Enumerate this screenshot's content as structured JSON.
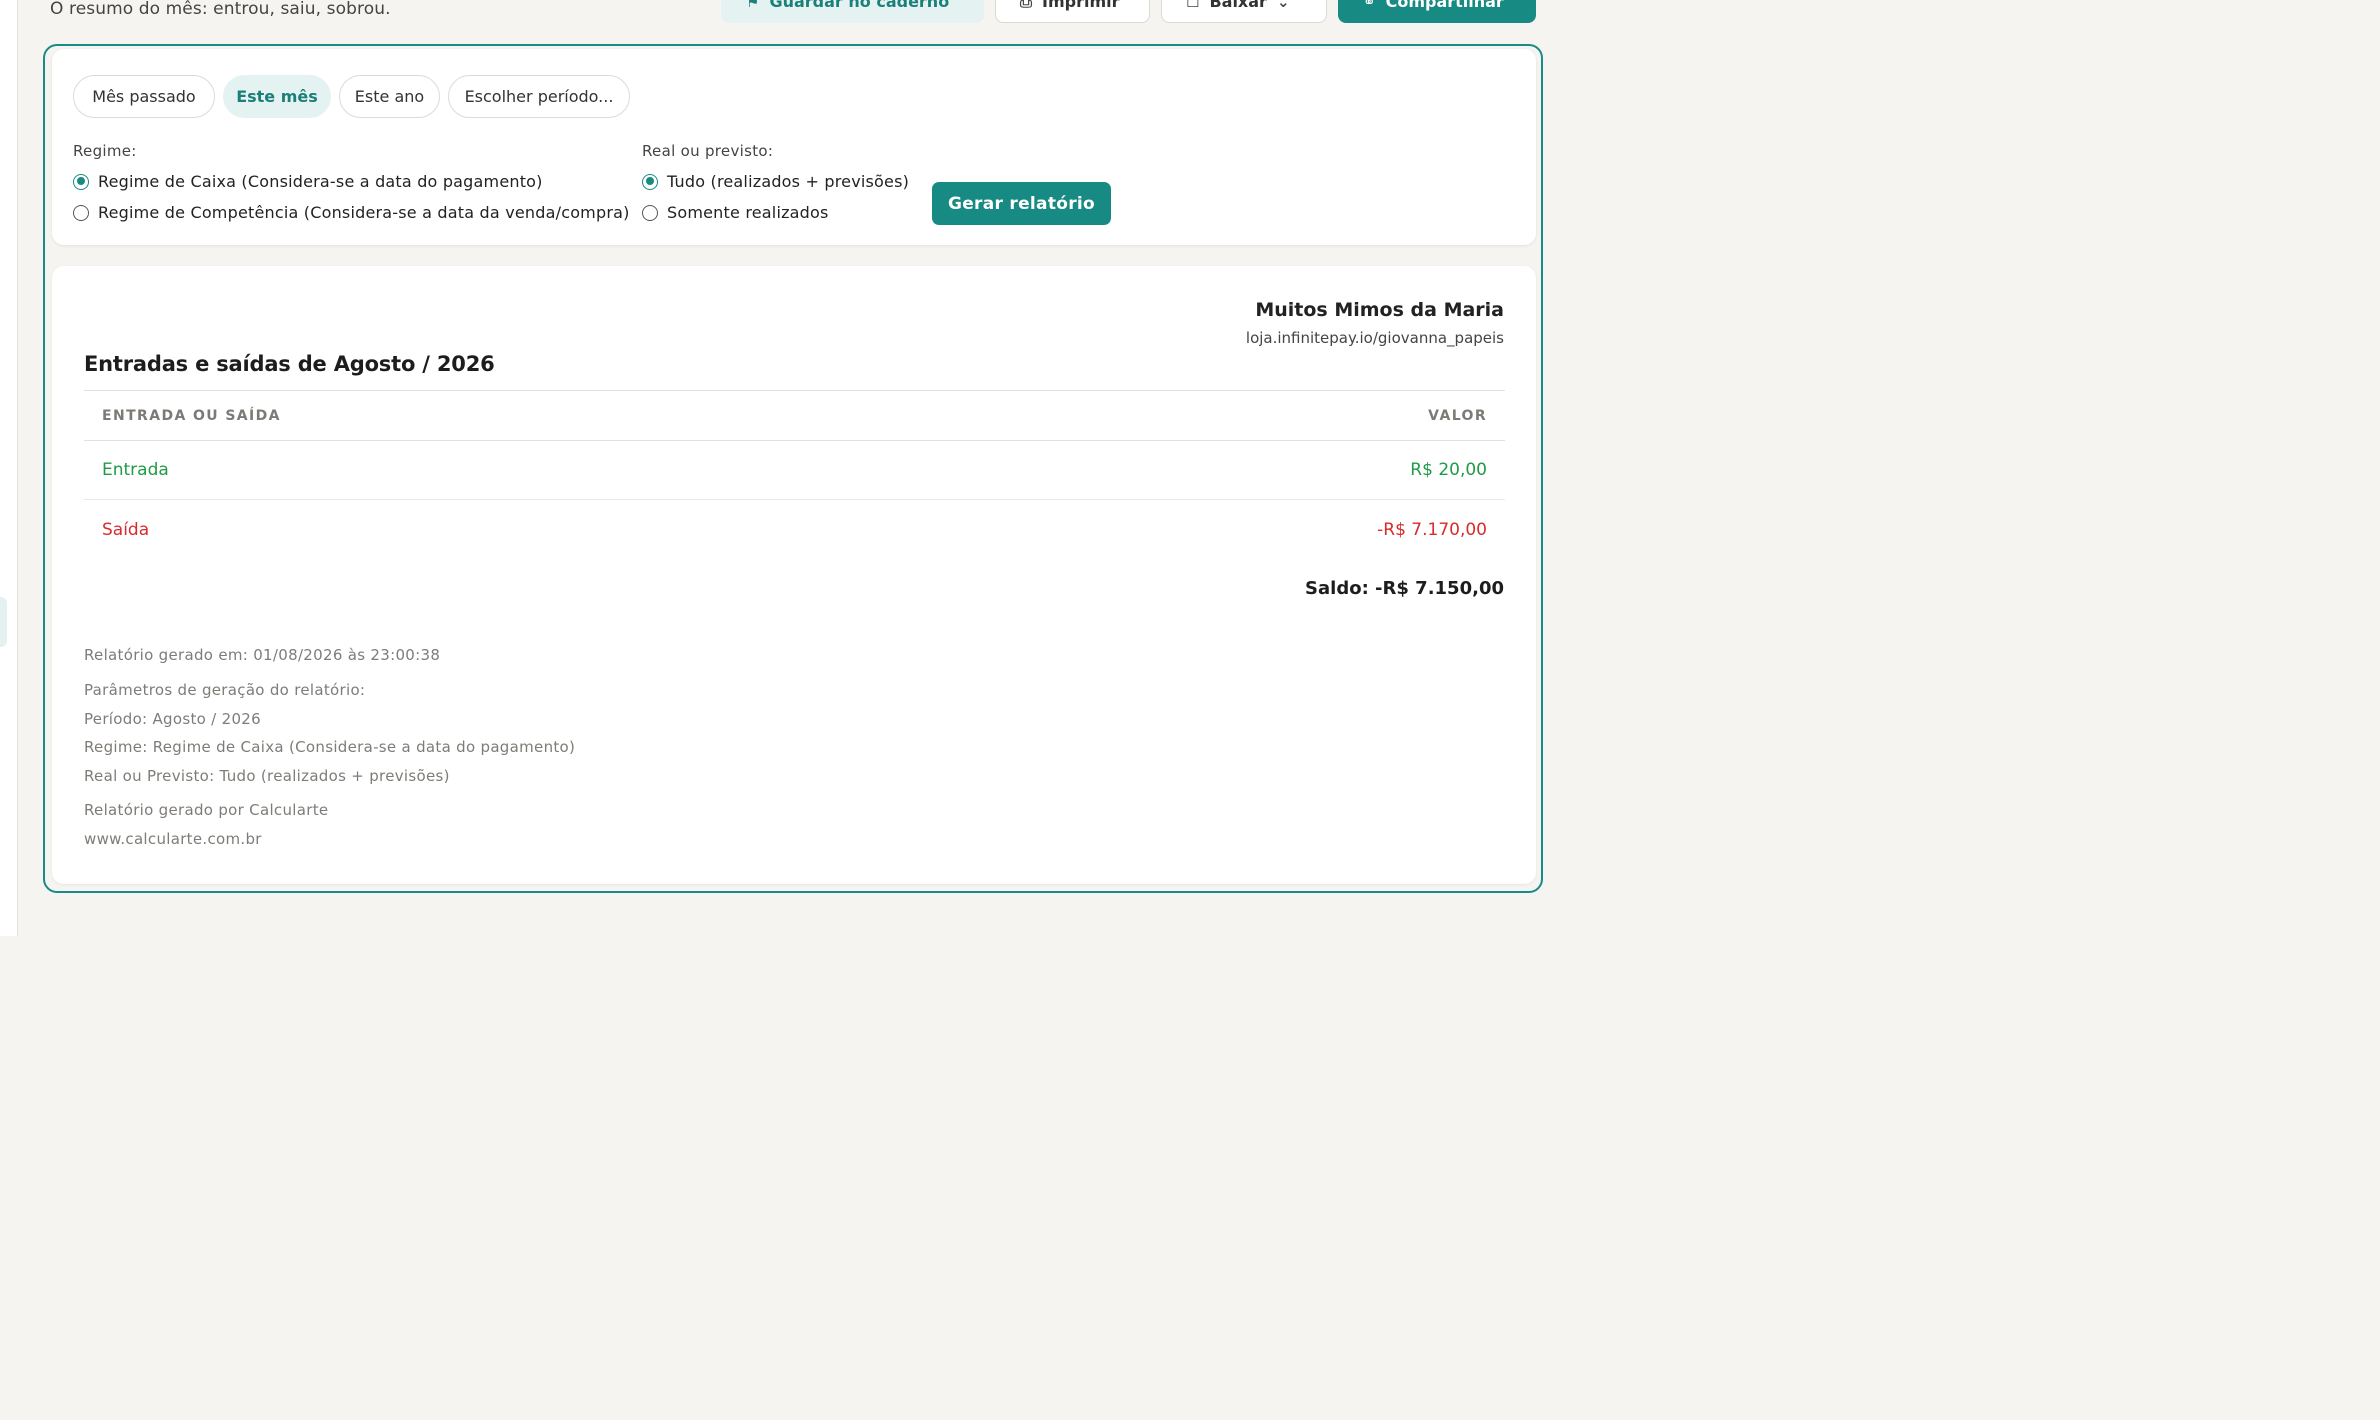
{
  "header": {
    "subtitle": "O resumo do mês: entrou, saiu, sobrou.",
    "buttons": {
      "save": "Guardar no caderno",
      "print": "Imprimir",
      "download": "Baixar",
      "share": "Compartilhar"
    }
  },
  "filters": {
    "periods": [
      "Mês passado",
      "Este mês",
      "Este ano",
      "Escolher período..."
    ],
    "active_period": "Este mês",
    "regime": {
      "label": "Regime:",
      "options": [
        "Regime de Caixa (Considera-se a data do pagamento)",
        "Regime de Competência (Considera-se a data da venda/compra)"
      ],
      "selected": "Regime de Caixa (Considera-se a data do pagamento)"
    },
    "real_previsto": {
      "label": "Real ou previsto:",
      "options": [
        "Tudo (realizados + previsões)",
        "Somente realizados"
      ],
      "selected": "Tudo (realizados + previsões)"
    },
    "generate_label": "Gerar relatório"
  },
  "report": {
    "company": "Muitos Mimos da Maria",
    "company_url": "loja.infinitepay.io/giovanna_papeis",
    "title": "Entradas e saídas de Agosto / 2026",
    "table": {
      "headers": [
        "ENTRADA OU SAÍDA",
        "VALOR"
      ],
      "rows": [
        {
          "label": "Entrada",
          "value": "R$ 20,00"
        },
        {
          "label": "Saída",
          "value": "-R$ 7.170,00"
        }
      ]
    },
    "balance": "Saldo: -R$ 7.150,00",
    "generated_at": "Relatório gerado em: 01/08/2026 às 23:00:38",
    "params_title": "Parâmetros de geração do relatório:",
    "params": [
      "Período: Agosto / 2026",
      "Regime: Regime de Caixa (Considera-se a data do pagamento)",
      "Real ou Previsto: Tudo (realizados + previsões)"
    ],
    "generated_by": "Relatório gerado por Calcularte",
    "site": "www.calcularte.com.br"
  },
  "colors": {
    "accent": "#188a84",
    "accent_light": "#e4f3f2",
    "income": "#1f9b47",
    "expense": "#d92b2b"
  },
  "icons": {
    "save": "bookmark-icon",
    "print": "printer-icon",
    "download": "download-icon",
    "share": "share-icon"
  }
}
